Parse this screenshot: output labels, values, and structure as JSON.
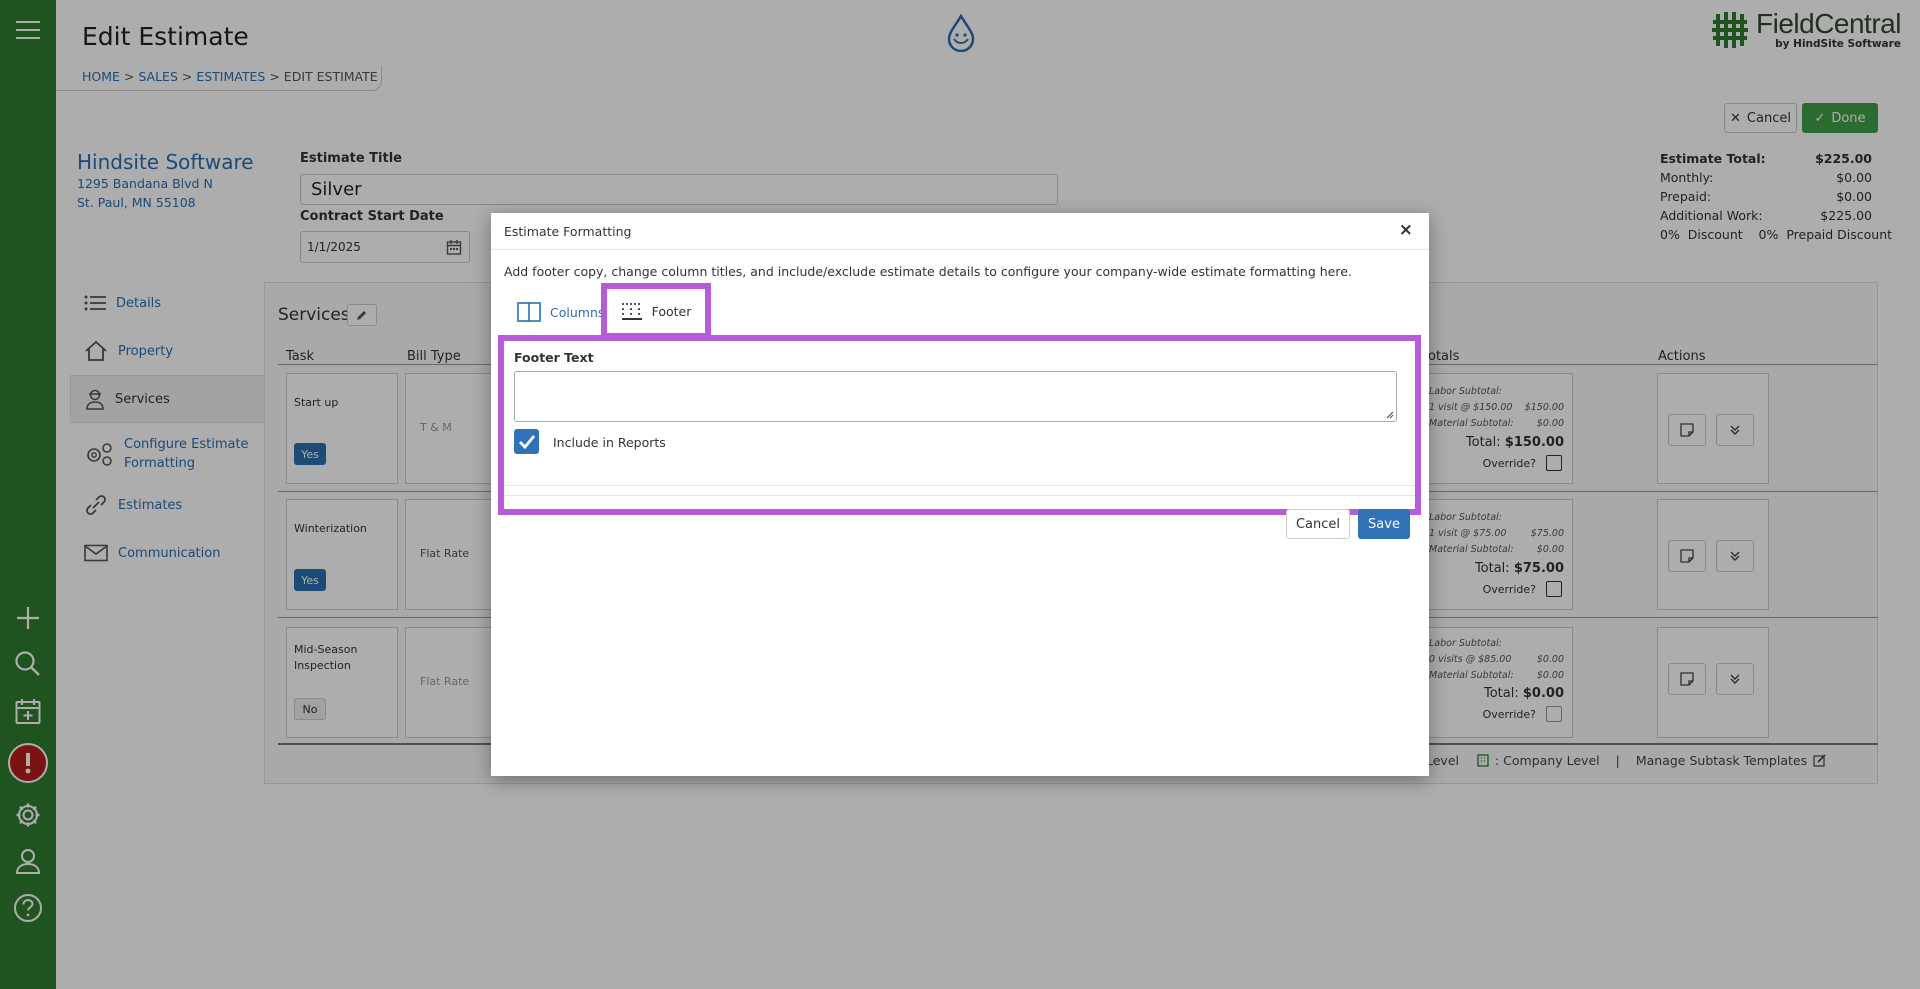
{
  "header": {
    "title": "Edit Estimate",
    "breadcrumb": {
      "home": "HOME",
      "sales": "SALES",
      "estimates": "ESTIMATES",
      "current": "EDIT ESTIMATE",
      "sep": ">"
    },
    "logo_name": "FieldCentral",
    "logo_sub": "by HindSite Software"
  },
  "sidebar": {
    "icons": [
      "menu-icon",
      "plus-icon",
      "search-icon",
      "calendar-add-icon",
      "alert-icon",
      "gear-icon",
      "user-icon",
      "help-icon"
    ]
  },
  "toolbar": {
    "cancel_label": "Cancel",
    "done_label": "Done"
  },
  "company": {
    "name": "Hindsite Software",
    "address1": "1295 Bandana Blvd N",
    "address2": "St. Paul, MN 55108"
  },
  "estimate": {
    "title_label": "Estimate Title",
    "title_value": "Silver",
    "start_label": "Contract Start Date",
    "start_value": "1/1/2025"
  },
  "totals": {
    "rows": [
      {
        "label": "Estimate Total:",
        "value": "$225.00"
      },
      {
        "label": "Monthly:",
        "value": "$0.00"
      },
      {
        "label": "Prepaid:",
        "value": "$0.00"
      },
      {
        "label": "Additional Work:",
        "value": "$225.00"
      }
    ],
    "discount_line": "0%  Discount    0%  Prepaid Discount"
  },
  "nav": [
    {
      "label": "Details",
      "icon": "list-icon"
    },
    {
      "label": "Property",
      "icon": "home-icon"
    },
    {
      "label": "Services",
      "icon": "worker-icon"
    },
    {
      "label": "Configure Estimate Formatting",
      "icon": "gears-icon"
    },
    {
      "label": "Estimates",
      "icon": "link-icon"
    },
    {
      "label": "Communication",
      "icon": "mail-icon"
    }
  ],
  "services": {
    "title": "Services",
    "columns": {
      "task": "Task",
      "bill_type": "Bill Type",
      "totals": "otals",
      "actions": "Actions"
    },
    "rows": [
      {
        "task": "Start up",
        "toggle": "Yes",
        "bill_type": "T & M",
        "labor": "Labor Subtotal:",
        "visits": "1 visit @ $150.00",
        "visits_amt": "$150.00",
        "material": "Material Subtotal:",
        "material_amt": "$0.00",
        "total_label": "Total:",
        "total": "$150.00",
        "override": "Override?"
      },
      {
        "task": "Winterization",
        "toggle": "Yes",
        "bill_type": "Flat Rate",
        "labor": "Labor Subtotal:",
        "visits": "1 visit @ $75.00",
        "visits_amt": "$75.00",
        "material": "Material Subtotal:",
        "material_amt": "$0.00",
        "total_label": "Total:",
        "total": "$75.00",
        "override": "Override?"
      },
      {
        "task": "Mid-Season Inspection",
        "toggle": "No",
        "bill_type": "Flat Rate",
        "labor": "Labor Subtotal:",
        "visits": "0 visits @ $85.00",
        "visits_amt": "$0.00",
        "material": "Material Subtotal:",
        "material_amt": "$0.00",
        "total_label": "Total:",
        "total": "$0.00",
        "override": "Override?"
      }
    ],
    "footer": {
      "level": "Level",
      "company_level": ": Company Level",
      "sep": "|",
      "manage": "Manage Subtask Templates"
    }
  },
  "modal": {
    "title": "Estimate Formatting",
    "close": "×",
    "description": "Add footer copy, change column titles, and include/exclude estimate details to configure your company-wide estimate formatting here.",
    "tabs": {
      "columns": "Columns",
      "footer": "Footer"
    },
    "footer_text_label": "Footer Text",
    "footer_text_value": "",
    "include_label": "Include in Reports",
    "include_checked": true,
    "cancel_label": "Cancel",
    "save_label": "Save"
  },
  "colors": {
    "sidebar": "#2e7d32",
    "accent": "#2a6fb0",
    "done": "#43a047",
    "highlight": "#b65bd9",
    "save": "#2f72b7"
  }
}
